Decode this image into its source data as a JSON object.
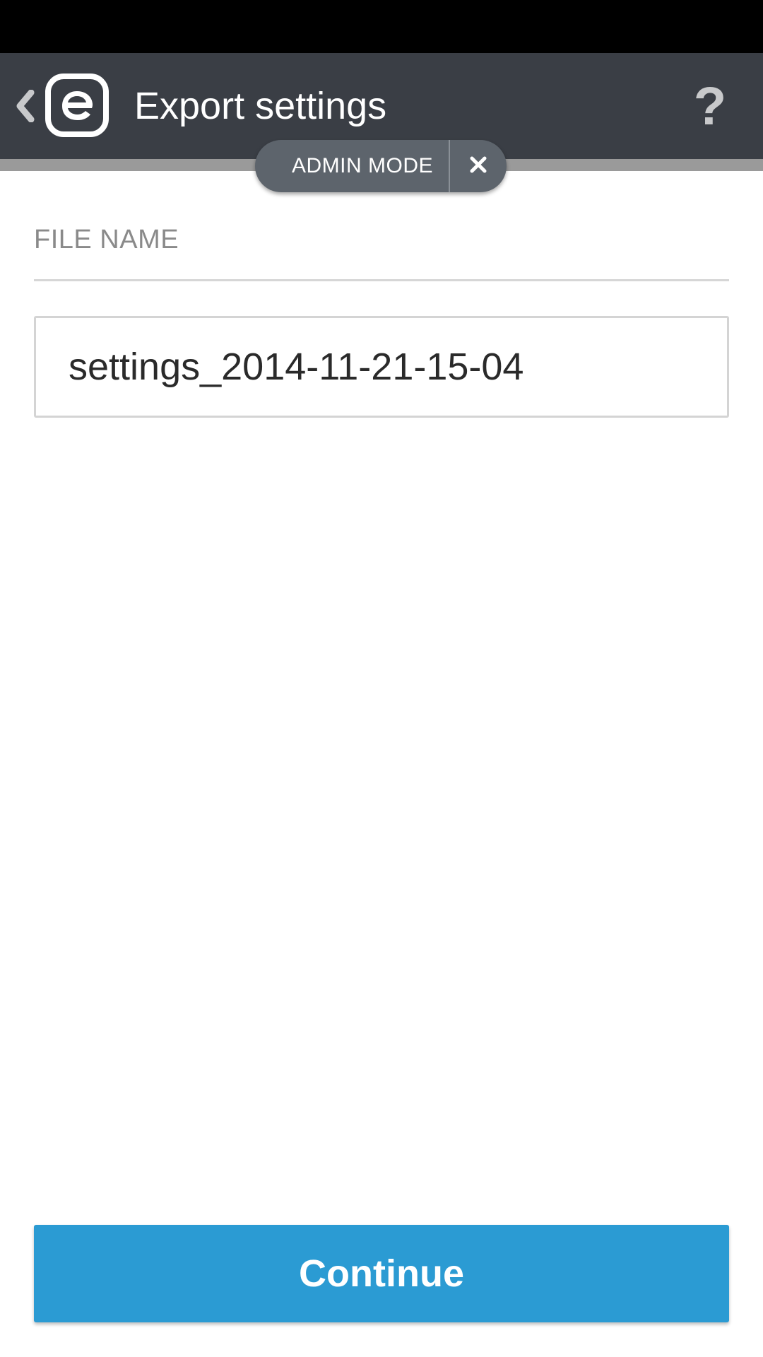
{
  "header": {
    "title": "Export settings",
    "back_icon": "chevron-left-icon",
    "logo_icon": "eset-logo-icon",
    "help_label": "?"
  },
  "admin_mode": {
    "label": "ADMIN MODE",
    "close_icon": "close-icon"
  },
  "form": {
    "section_label": "FILE NAME",
    "file_name_value": "settings_2014-11-21-15-04"
  },
  "footer": {
    "continue_label": "Continue"
  },
  "colors": {
    "app_bar": "#3a3e45",
    "accent": "#2b9bd3",
    "pill": "#5d646c"
  }
}
